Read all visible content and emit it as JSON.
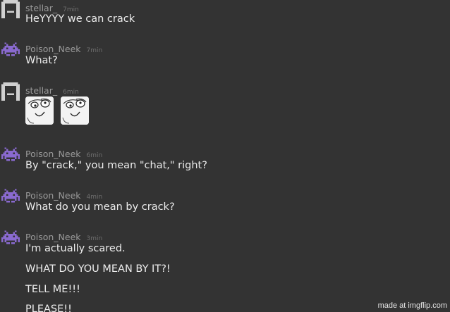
{
  "messages": [
    {
      "user": "stellar_",
      "avatar": "gray-pixel-avatar-icon",
      "time": "7min",
      "lines": [
        "HeYYYY we can crack"
      ]
    },
    {
      "user": "Poison_Neek",
      "avatar": "purple-space-invader-avatar-icon",
      "time": "7min",
      "lines": [
        "What?"
      ]
    },
    {
      "user": "stellar_",
      "avatar": "gray-pixel-avatar-icon",
      "time": "6min",
      "emotes": [
        "derp-face-emote-icon",
        "derp-face-emote-icon"
      ]
    },
    {
      "user": "Poison_Neek",
      "avatar": "purple-space-invader-avatar-icon",
      "time": "6min",
      "lines": [
        "By \"crack,\" you mean \"chat,\" right?"
      ]
    },
    {
      "user": "Poison_Neek",
      "avatar": "purple-space-invader-avatar-icon",
      "time": "4min",
      "lines": [
        "What do you mean by crack?"
      ]
    },
    {
      "user": "Poison_Neek",
      "avatar": "purple-space-invader-avatar-icon",
      "time": "3min",
      "lines": [
        "I'm actually scared.",
        "WHAT DO YOU MEAN BY IT?!",
        "TELL ME!!!",
        "PLEASE!!"
      ]
    }
  ],
  "watermark": "made at imgflip.com",
  "colors": {
    "background": "#333333",
    "username": "#9a9a9a",
    "timestamp": "#6f6f6f",
    "message_text": "#ececec",
    "purple_avatar": "#8a6ad0",
    "gray_avatar": "#d0d0d0"
  }
}
